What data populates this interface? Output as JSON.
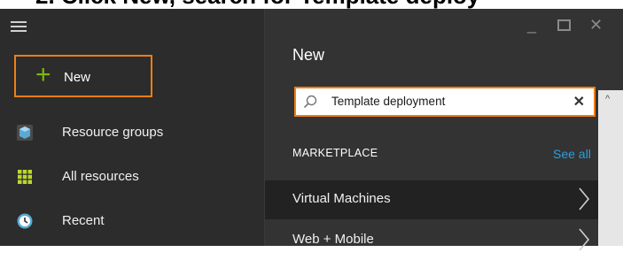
{
  "caption": {
    "text": "2. Click New, search for Template deploy"
  },
  "sidebar": {
    "new_label": "New",
    "items": [
      {
        "label": "Resource groups",
        "icon": "resource-groups-icon"
      },
      {
        "label": "All resources",
        "icon": "all-resources-icon"
      },
      {
        "label": "Recent",
        "icon": "recent-icon"
      }
    ]
  },
  "panel": {
    "title": "New",
    "search": {
      "value": "Template deployment",
      "placeholder": ""
    },
    "section_label": "MARKETPLACE",
    "see_all": "See all",
    "rows": [
      {
        "label": "Virtual Machines"
      },
      {
        "label": "Web + Mobile"
      }
    ]
  },
  "colors": {
    "highlight": "#f07e15",
    "accent_plus": "#7fba00",
    "link": "#2aa0e0",
    "sidebar_bg": "#2c2c2c",
    "panel_bg": "#333334",
    "row_selected": "#222222"
  }
}
